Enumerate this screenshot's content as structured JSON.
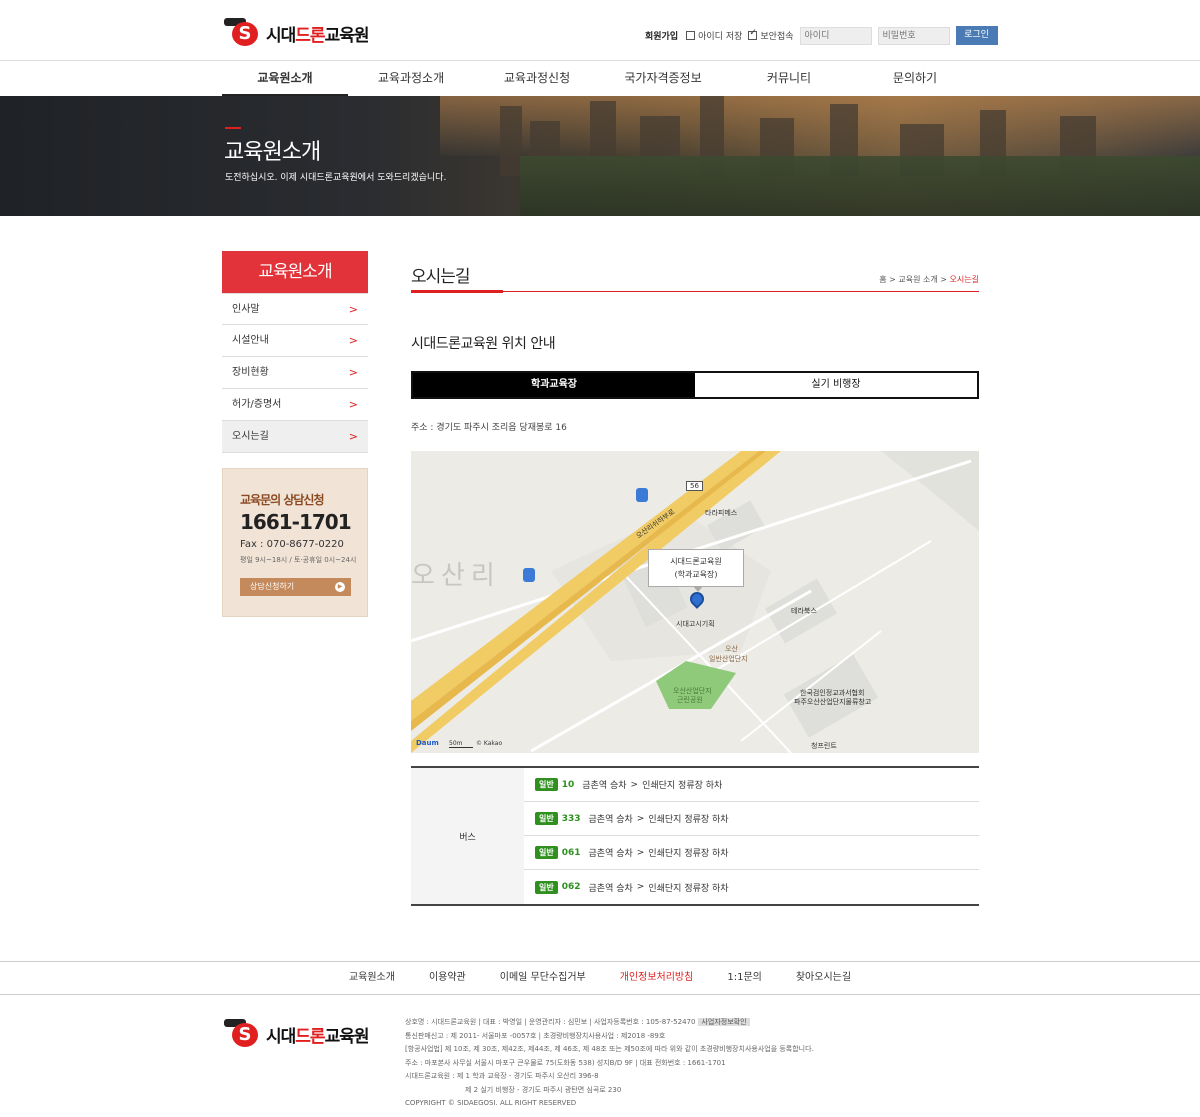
{
  "header": {
    "logo_prefix": "시대",
    "logo_red": "드론",
    "logo_suffix": "교육원",
    "join": "회원가입",
    "save_id": "아이디 저장",
    "secure": "보안접속",
    "id_placeholder": "아이디",
    "pw_placeholder": "비밀번호",
    "login_btn": "로그인"
  },
  "nav": {
    "items": [
      "교육원소개",
      "교육과정소개",
      "교육과정신청",
      "국가자격증정보",
      "커뮤니티",
      "문의하기"
    ]
  },
  "hero": {
    "title": "교육원소개",
    "subtitle": "도전하십시오. 이제 시대드론교육원에서 도와드리겠습니다."
  },
  "sidebar": {
    "title": "교육원소개",
    "items": [
      "인사말",
      "시설안내",
      "장비현황",
      "허가/증명서",
      "오시는길"
    ],
    "arrow": ">"
  },
  "consult": {
    "title": "교육문의 상담신청",
    "phone": "1661-1701",
    "fax": "Fax : 070-8677-0220",
    "hours": "평일 9시~18시 / 토·공휴일 0시~24시",
    "button": "상담신청하기",
    "button_icon": "▶"
  },
  "main": {
    "title": "오시는길",
    "breadcrumb_home": "홈 > 교육원 소개 > ",
    "breadcrumb_current": "오시는길",
    "subtitle": "시대드론교육원 위치 안내",
    "tabs": [
      "학과교육장",
      "실기 비행장"
    ],
    "address": "주소 : 경기도 파주시 조리읍 당재봉로 16"
  },
  "map": {
    "pin_line1": "시대드론교육원",
    "pin_line2": "(학과교육장)",
    "labels": {
      "taraphimes": "타라피메스",
      "pin_place": "시대고시기획",
      "terabooks": "테라북스",
      "osan_ind": "오산",
      "osan_ind2": "일반산업단지",
      "park": "오산산업단지",
      "park2": "근린공원",
      "hankook1": "한국검인정교과서협회",
      "hankook2": "파주오산산업단지물류창고",
      "cheongprint": "청프린트",
      "road_no": "56",
      "road_name": "오산리쉬하부로",
      "big": "오산리"
    },
    "daum": "Daum",
    "scale": "50m",
    "copyright": "© Kakao"
  },
  "traffic": {
    "category": "버스",
    "routes": [
      {
        "tag": "일반",
        "num": "10",
        "from": "금촌역 승차",
        "to": "인쇄단지 정류장 하차"
      },
      {
        "tag": "일반",
        "num": "333",
        "from": "금촌역 승차",
        "to": "인쇄단지 정류장 하차"
      },
      {
        "tag": "일반",
        "num": "061",
        "from": "금촌역 승차",
        "to": "인쇄단지 정류장 하차"
      },
      {
        "tag": "일반",
        "num": "062",
        "from": "금촌역 승차",
        "to": "인쇄단지 정류장 하차"
      }
    ],
    "sep": ">"
  },
  "footer": {
    "nav": [
      "교육원소개",
      "이용약관",
      "이메일 무단수집거부",
      "개인정보처리방침",
      "1:1문의",
      "찾아오시는길"
    ],
    "info": [
      "상호명 : 시대드론교육원 | 대표 : 박영일 | 운영관리자 : 심민보 | 사업자등록번호 : 105-87-52470",
      "통신판매신고 : 제 2011- 서울마포 -0057호 | 초경량비행장치사용사업 : 제2018 -89호",
      "[항공사업법] 제 10조, 제 30조, 제42조, 제44조, 제 46조, 제 48조 또는 제50조에 따라 위와 같이 초경량비행장치사용사업을 등록합니다.",
      "주소 : 마포본사 사무실 서울시 마포구 큰우물로 75(도화동 538) 성지B/D 9F | 대표 전화번호 : 1661-1701",
      "시대드론교육원 : 제 1 학과 교육장 - 경기도 파주시 오산리 396-8",
      "제 2 실기 비행장 - 경기도 파주시 광탄면 심곡로 230",
      "COPYRIGHT © SIDAEGOSI. ALL RIGHT RESERVED"
    ],
    "badge": "사업자정보확인"
  }
}
